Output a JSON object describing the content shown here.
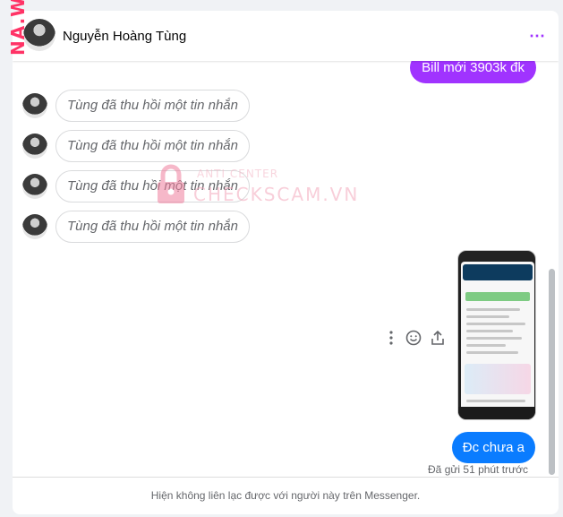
{
  "header": {
    "name": "Nguyễn Hoàng Tùng",
    "more_icon": "⋯"
  },
  "messages": {
    "sent_top": "Bill mới 3903k đk",
    "unsent": [
      "Tùng đã thu hồi một tin nhắn",
      "Tùng đã thu hồi một tin nhắn",
      "Tùng đã thu hồi một tin nhắn",
      "Tùng đã thu hồi một tin nhắn"
    ],
    "sent_last": "Đc chưa a",
    "status": "Đã gửi 51 phút trước"
  },
  "footer": {
    "notice": "Hiện không liên lạc được với người này trên Messenger."
  },
  "watermark": {
    "top": "ANTI CENTER",
    "main": "CHECKSCAM.VN",
    "side": "NA.W"
  },
  "colors": {
    "accent": "#a033ff",
    "messenger_blue": "#0a7cff"
  }
}
